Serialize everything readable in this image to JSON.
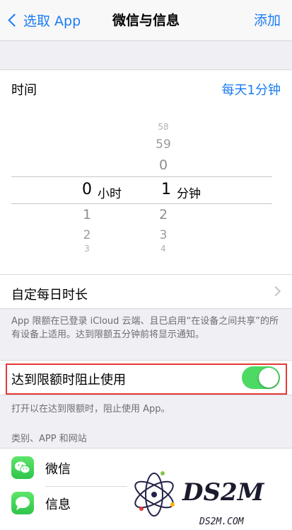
{
  "nav": {
    "back_label": "选取 App",
    "title": "微信与信息",
    "add_label": "添加"
  },
  "time_row": {
    "label": "时间",
    "value": "每天1分钟"
  },
  "picker": {
    "hours": {
      "above": [
        "",
        "",
        ""
      ],
      "selected": "0",
      "unit": "小时",
      "below": [
        "1",
        "2",
        "3"
      ]
    },
    "minutes": {
      "above": [
        "58",
        "59",
        "0"
      ],
      "selected": "1",
      "unit": "分钟",
      "below": [
        "2",
        "3",
        "4"
      ]
    }
  },
  "custom_daily": {
    "label": "自定每日时长"
  },
  "limit_note": "App 限额在已登录 iCloud 云端、且已启用“在设备之间共享”的所有设备上适用。达到限额五分钟前将显示通知。",
  "block_at_limit": {
    "label": "达到限额时阻止使用",
    "enabled": true
  },
  "block_note": "打开以在达到限额时，阻止使用 App。",
  "category_header": "类别、APP 和网站",
  "apps": [
    {
      "name": "微信",
      "icon": "wechat-icon"
    },
    {
      "name": "信息",
      "icon": "messages-icon"
    }
  ],
  "watermark": {
    "logo_text": "DS2M",
    "domain": "DS2M.COM"
  },
  "colors": {
    "accent": "#1a7cf5",
    "toggle_on": "#4cd964",
    "highlight": "#e53935"
  }
}
